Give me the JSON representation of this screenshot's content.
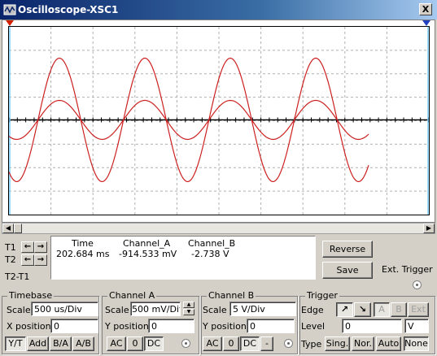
{
  "window": {
    "title": "Oscilloscope-XSC1",
    "close_label": "X"
  },
  "cursor_labels": {
    "t1": "T1",
    "t2": "T2",
    "t2_t1": "T2-T1",
    "left": "←",
    "right": "→"
  },
  "readout": {
    "headers": {
      "time": "Time",
      "channel_a": "Channel_A",
      "channel_b": "Channel_B"
    },
    "row": {
      "time": "202.684 ms",
      "channel_a": "-914.533 mV",
      "channel_b": "-2.738 V"
    }
  },
  "buttons": {
    "reverse": "Reverse",
    "save": "Save",
    "ext_trigger": "Ext. Trigger"
  },
  "timebase": {
    "title": "Timebase",
    "scale_label": "Scale",
    "scale_value": "500 us/Div",
    "xpos_label": "X position",
    "xpos_value": "0",
    "modes": [
      "Y/T",
      "Add",
      "B/A",
      "A/B"
    ]
  },
  "channel_a": {
    "title": "Channel A",
    "scale_label": "Scale",
    "scale_value": "500 mV/Div",
    "ypos_label": "Y position",
    "ypos_value": "0",
    "coupling": [
      "AC",
      "0",
      "DC"
    ]
  },
  "channel_b": {
    "title": "Channel B",
    "scale_label": "Scale",
    "scale_value": "5  V/Div",
    "ypos_label": "Y position",
    "ypos_value": "0",
    "coupling": [
      "AC",
      "0",
      "DC",
      "-"
    ]
  },
  "trigger": {
    "title": "Trigger",
    "edge_label": "Edge",
    "edge_rising": "↗",
    "edge_falling": "↘",
    "sources": [
      "A",
      "B",
      "Ext"
    ],
    "level_label": "Level",
    "level_value": "0",
    "level_unit": "V",
    "type_label": "Type",
    "types": [
      "Sing.",
      "Nor.",
      "Auto",
      "None"
    ]
  },
  "colors": {
    "trace": "#cc2020",
    "grid": "#b0b0b0",
    "title_bar": "#0a246a",
    "cursor_t1": "#d02000",
    "cursor_t2": "#2040c0"
  },
  "icons": {
    "app": "oscilloscope-icon",
    "close": "close-icon"
  }
}
